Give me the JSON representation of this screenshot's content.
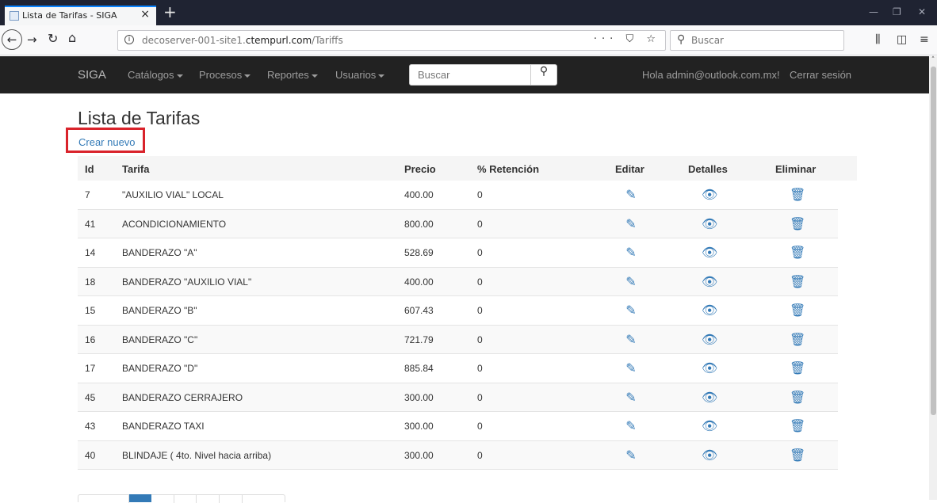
{
  "browser": {
    "tab_title": "Lista de Tarifas - SIGA",
    "tab_close": "×",
    "new_tab": "+",
    "url_host": "decoserver-001-site1.",
    "url_domain": "ctempurl.com",
    "url_path": "/Tariffs",
    "url_actions": "··· ⛉ ☆",
    "search_placeholder": "Buscar",
    "win_min": "—",
    "win_max": "❐",
    "win_close": "✕"
  },
  "navbar": {
    "brand": "SIGA",
    "menus": [
      {
        "label": "Catálogos"
      },
      {
        "label": "Procesos"
      },
      {
        "label": "Reportes"
      },
      {
        "label": "Usuarios"
      }
    ],
    "search_placeholder": "Buscar",
    "greeting": "Hola admin@outlook.com.mx!",
    "logout": "Cerrar sesión"
  },
  "page": {
    "title": "Lista de Tarifas",
    "create_link": "Crear nuevo"
  },
  "table": {
    "headers": {
      "id": "Id",
      "tarifa": "Tarifa",
      "precio": "Precio",
      "retencion": "% Retención",
      "editar": "Editar",
      "detalles": "Detalles",
      "eliminar": "Eliminar"
    },
    "rows": [
      {
        "id": "7",
        "tarifa": "\"AUXILIO VIAL\" LOCAL",
        "precio": "400.00",
        "retencion": "0"
      },
      {
        "id": "41",
        "tarifa": "ACONDICIONAMIENTO",
        "precio": "800.00",
        "retencion": "0"
      },
      {
        "id": "14",
        "tarifa": "BANDERAZO \"A\"",
        "precio": "528.69",
        "retencion": "0"
      },
      {
        "id": "18",
        "tarifa": "BANDERAZO \"AUXILIO VIAL\"",
        "precio": "400.00",
        "retencion": "0"
      },
      {
        "id": "15",
        "tarifa": "BANDERAZO \"B\"",
        "precio": "607.43",
        "retencion": "0"
      },
      {
        "id": "16",
        "tarifa": "BANDERAZO \"C\"",
        "precio": "721.79",
        "retencion": "0"
      },
      {
        "id": "17",
        "tarifa": "BANDERAZO \"D\"",
        "precio": "885.84",
        "retencion": "0"
      },
      {
        "id": "45",
        "tarifa": "BANDERAZO CERRAJERO",
        "precio": "300.00",
        "retencion": "0"
      },
      {
        "id": "43",
        "tarifa": "BANDERAZO TAXI",
        "precio": "300.00",
        "retencion": "0"
      },
      {
        "id": "40",
        "tarifa": "BLINDAJE ( 4to. Nivel hacia arriba)",
        "precio": "300.00",
        "retencion": "0"
      }
    ],
    "icons": {
      "edit": "✎",
      "view": "👁",
      "delete": "🗑"
    }
  },
  "colors": {
    "navbar_bg": "#222222",
    "link": "#337ab7",
    "highlight_box": "#d9232b"
  }
}
